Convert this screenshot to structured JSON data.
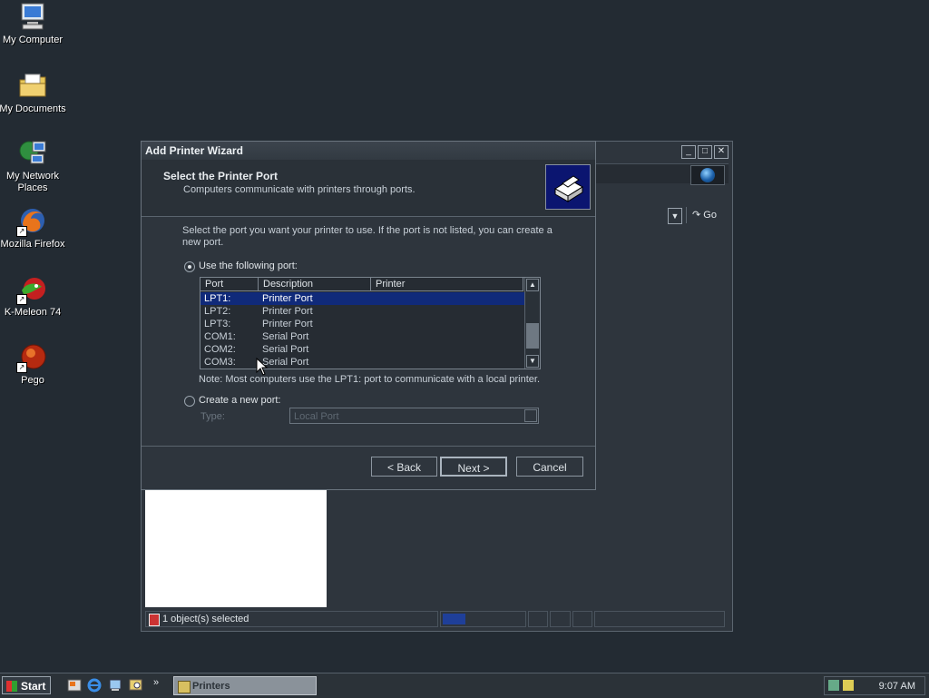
{
  "desktop": {
    "icons": [
      {
        "label": "My Computer",
        "icon": "computer-icon"
      },
      {
        "label": "My Documents",
        "icon": "folder-documents-icon"
      },
      {
        "label": "My Network Places",
        "icon": "network-icon"
      },
      {
        "label": "Mozilla Firefox",
        "icon": "firefox-icon"
      },
      {
        "label": "K-Meleon 74",
        "icon": "kmeleon-icon"
      },
      {
        "label": "Pego",
        "icon": "pego-icon"
      }
    ]
  },
  "explorer": {
    "controls": {
      "minimize": "_",
      "maximize": "□",
      "close": "✕"
    },
    "go_label": "Go",
    "status": {
      "text": "1 object(s) selected",
      "progress": 0.28
    }
  },
  "wizard": {
    "title": "Add Printer Wizard",
    "header_title": "Select the Printer Port",
    "header_subtitle": "Computers communicate with printers through ports.",
    "instructions": "Select the port you want your printer to use.  If the port is not listed, you can create a new port.",
    "radio_use": "Use the following port:",
    "columns": [
      "Port",
      "Description",
      "Printer"
    ],
    "ports": [
      {
        "port": "LPT1:",
        "description": "Printer Port",
        "printer": "",
        "selected": true
      },
      {
        "port": "LPT2:",
        "description": "Printer Port",
        "printer": ""
      },
      {
        "port": "LPT3:",
        "description": "Printer Port",
        "printer": ""
      },
      {
        "port": "COM1:",
        "description": "Serial Port",
        "printer": ""
      },
      {
        "port": "COM2:",
        "description": "Serial Port",
        "printer": ""
      },
      {
        "port": "COM3:",
        "description": "Serial Port",
        "printer": ""
      }
    ],
    "note": "Note: Most computers use the LPT1: port to communicate with a local printer.",
    "radio_create": "Create a new port:",
    "type_label": "Type:",
    "type_value": "Local Port",
    "buttons": {
      "back": "< Back",
      "next": "Next >",
      "cancel": "Cancel"
    }
  },
  "taskbar": {
    "start_label": "Start",
    "task_label": "Printers",
    "clock": "9:07 AM",
    "chevron": "»"
  }
}
